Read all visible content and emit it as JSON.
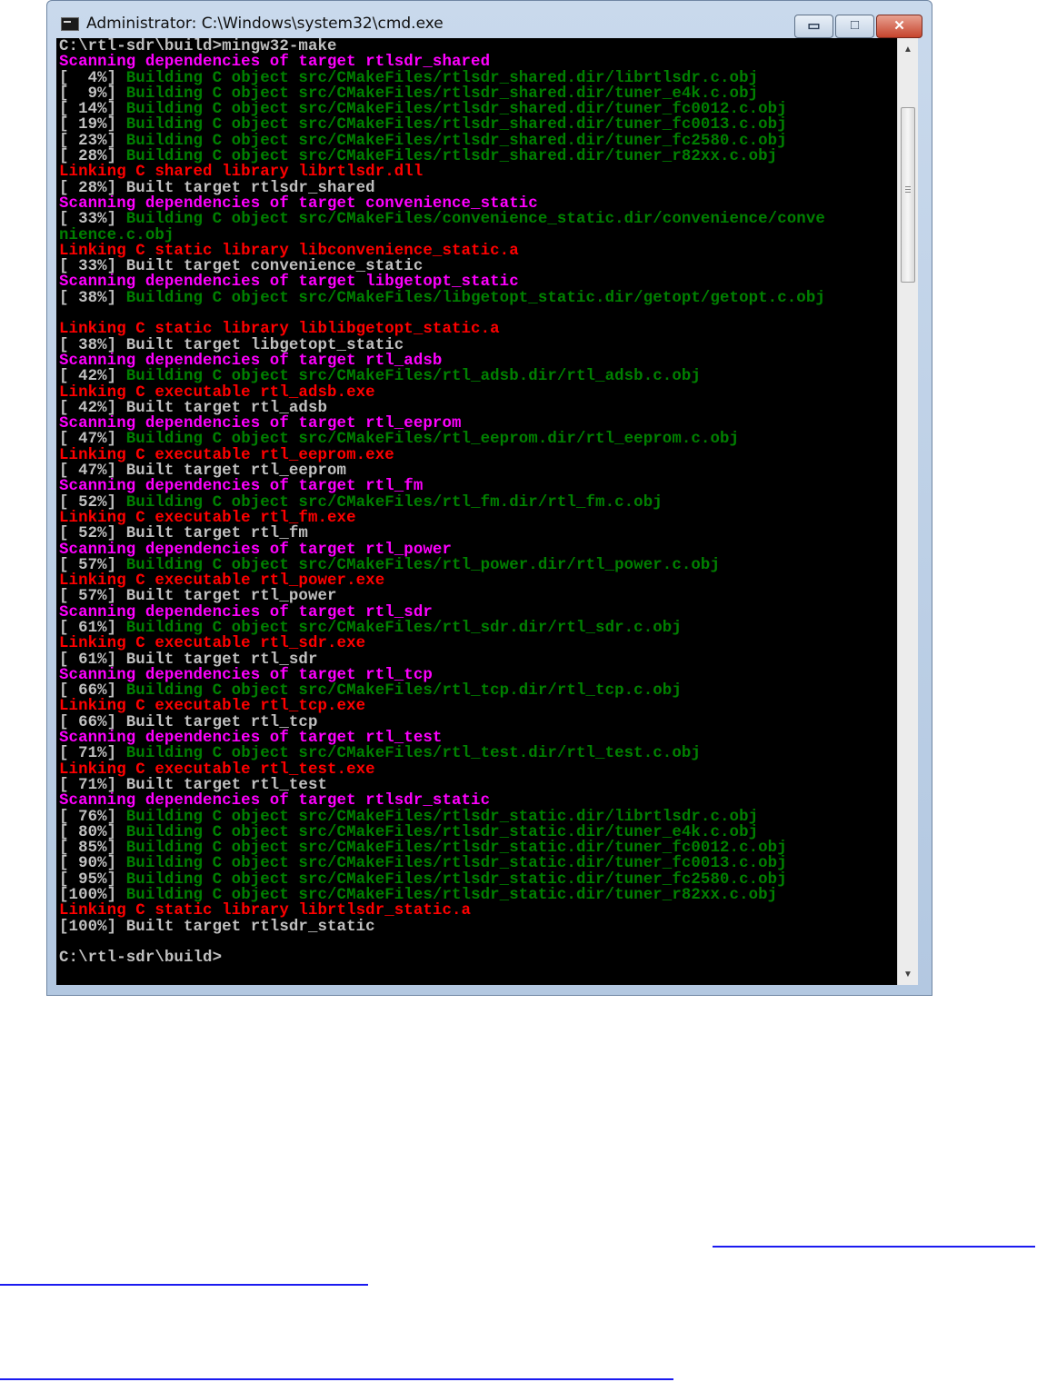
{
  "window": {
    "title": "Administrator: C:\\Windows\\system32\\cmd.exe",
    "controls": {
      "minimize": "▭",
      "maximize": "□",
      "close": "✕"
    }
  },
  "colors": {
    "white": "#c0c0c0",
    "magenta": "#ff00ff",
    "green": "#008000",
    "red": "#ff0000"
  },
  "console": {
    "lines": [
      {
        "c": "white",
        "t": "C:\\rtl-sdr\\build>mingw32-make"
      },
      {
        "c": "magenta",
        "t": "Scanning dependencies of target rtlsdr_shared"
      },
      {
        "c": "white",
        "t": "[  4%] ",
        "t2": "Building C object src/CMakeFiles/rtlsdr_shared.dir/librtlsdr.c.obj",
        "c2": "green"
      },
      {
        "c": "white",
        "t": "[  9%] ",
        "t2": "Building C object src/CMakeFiles/rtlsdr_shared.dir/tuner_e4k.c.obj",
        "c2": "green"
      },
      {
        "c": "white",
        "t": "[ 14%] ",
        "t2": "Building C object src/CMakeFiles/rtlsdr_shared.dir/tuner_fc0012.c.obj",
        "c2": "green"
      },
      {
        "c": "white",
        "t": "[ 19%] ",
        "t2": "Building C object src/CMakeFiles/rtlsdr_shared.dir/tuner_fc0013.c.obj",
        "c2": "green"
      },
      {
        "c": "white",
        "t": "[ 23%] ",
        "t2": "Building C object src/CMakeFiles/rtlsdr_shared.dir/tuner_fc2580.c.obj",
        "c2": "green"
      },
      {
        "c": "white",
        "t": "[ 28%] ",
        "t2": "Building C object src/CMakeFiles/rtlsdr_shared.dir/tuner_r82xx.c.obj",
        "c2": "green"
      },
      {
        "c": "red",
        "t": "Linking C shared library librtlsdr.dll"
      },
      {
        "c": "white",
        "t": "[ 28%] Built target rtlsdr_shared"
      },
      {
        "c": "magenta",
        "t": "Scanning dependencies of target convenience_static"
      },
      {
        "c": "white",
        "t": "[ 33%] ",
        "t2": "Building C object src/CMakeFiles/convenience_static.dir/convenience/conve",
        "c2": "green"
      },
      {
        "c": "green",
        "t": "nience.c.obj"
      },
      {
        "c": "red",
        "t": "Linking C static library libconvenience_static.a"
      },
      {
        "c": "white",
        "t": "[ 33%] Built target convenience_static"
      },
      {
        "c": "magenta",
        "t": "Scanning dependencies of target libgetopt_static"
      },
      {
        "c": "white",
        "t": "[ 38%] ",
        "t2": "Building C object src/CMakeFiles/libgetopt_static.dir/getopt/getopt.c.obj",
        "c2": "green"
      },
      {
        "c": "white",
        "t": ""
      },
      {
        "c": "red",
        "t": "Linking C static library liblibgetopt_static.a"
      },
      {
        "c": "white",
        "t": "[ 38%] Built target libgetopt_static"
      },
      {
        "c": "magenta",
        "t": "Scanning dependencies of target rtl_adsb"
      },
      {
        "c": "white",
        "t": "[ 42%] ",
        "t2": "Building C object src/CMakeFiles/rtl_adsb.dir/rtl_adsb.c.obj",
        "c2": "green"
      },
      {
        "c": "red",
        "t": "Linking C executable rtl_adsb.exe"
      },
      {
        "c": "white",
        "t": "[ 42%] Built target rtl_adsb"
      },
      {
        "c": "magenta",
        "t": "Scanning dependencies of target rtl_eeprom"
      },
      {
        "c": "white",
        "t": "[ 47%] ",
        "t2": "Building C object src/CMakeFiles/rtl_eeprom.dir/rtl_eeprom.c.obj",
        "c2": "green"
      },
      {
        "c": "red",
        "t": "Linking C executable rtl_eeprom.exe"
      },
      {
        "c": "white",
        "t": "[ 47%] Built target rtl_eeprom"
      },
      {
        "c": "magenta",
        "t": "Scanning dependencies of target rtl_fm"
      },
      {
        "c": "white",
        "t": "[ 52%] ",
        "t2": "Building C object src/CMakeFiles/rtl_fm.dir/rtl_fm.c.obj",
        "c2": "green"
      },
      {
        "c": "red",
        "t": "Linking C executable rtl_fm.exe"
      },
      {
        "c": "white",
        "t": "[ 52%] Built target rtl_fm"
      },
      {
        "c": "magenta",
        "t": "Scanning dependencies of target rtl_power"
      },
      {
        "c": "white",
        "t": "[ 57%] ",
        "t2": "Building C object src/CMakeFiles/rtl_power.dir/rtl_power.c.obj",
        "c2": "green"
      },
      {
        "c": "red",
        "t": "Linking C executable rtl_power.exe"
      },
      {
        "c": "white",
        "t": "[ 57%] Built target rtl_power"
      },
      {
        "c": "magenta",
        "t": "Scanning dependencies of target rtl_sdr"
      },
      {
        "c": "white",
        "t": "[ 61%] ",
        "t2": "Building C object src/CMakeFiles/rtl_sdr.dir/rtl_sdr.c.obj",
        "c2": "green"
      },
      {
        "c": "red",
        "t": "Linking C executable rtl_sdr.exe"
      },
      {
        "c": "white",
        "t": "[ 61%] Built target rtl_sdr"
      },
      {
        "c": "magenta",
        "t": "Scanning dependencies of target rtl_tcp"
      },
      {
        "c": "white",
        "t": "[ 66%] ",
        "t2": "Building C object src/CMakeFiles/rtl_tcp.dir/rtl_tcp.c.obj",
        "c2": "green"
      },
      {
        "c": "red",
        "t": "Linking C executable rtl_tcp.exe"
      },
      {
        "c": "white",
        "t": "[ 66%] Built target rtl_tcp"
      },
      {
        "c": "magenta",
        "t": "Scanning dependencies of target rtl_test"
      },
      {
        "c": "white",
        "t": "[ 71%] ",
        "t2": "Building C object src/CMakeFiles/rtl_test.dir/rtl_test.c.obj",
        "c2": "green"
      },
      {
        "c": "red",
        "t": "Linking C executable rtl_test.exe"
      },
      {
        "c": "white",
        "t": "[ 71%] Built target rtl_test"
      },
      {
        "c": "magenta",
        "t": "Scanning dependencies of target rtlsdr_static"
      },
      {
        "c": "white",
        "t": "[ 76%] ",
        "t2": "Building C object src/CMakeFiles/rtlsdr_static.dir/librtlsdr.c.obj",
        "c2": "green"
      },
      {
        "c": "white",
        "t": "[ 80%] ",
        "t2": "Building C object src/CMakeFiles/rtlsdr_static.dir/tuner_e4k.c.obj",
        "c2": "green"
      },
      {
        "c": "white",
        "t": "[ 85%] ",
        "t2": "Building C object src/CMakeFiles/rtlsdr_static.dir/tuner_fc0012.c.obj",
        "c2": "green"
      },
      {
        "c": "white",
        "t": "[ 90%] ",
        "t2": "Building C object src/CMakeFiles/rtlsdr_static.dir/tuner_fc0013.c.obj",
        "c2": "green"
      },
      {
        "c": "white",
        "t": "[ 95%] ",
        "t2": "Building C object src/CMakeFiles/rtlsdr_static.dir/tuner_fc2580.c.obj",
        "c2": "green"
      },
      {
        "c": "white",
        "t": "[100%] ",
        "t2": "Building C object src/CMakeFiles/rtlsdr_static.dir/tuner_r82xx.c.obj",
        "c2": "green"
      },
      {
        "c": "red",
        "t": "Linking C static library librtlsdr_static.a"
      },
      {
        "c": "white",
        "t": "[100%] Built target rtlsdr_static"
      },
      {
        "c": "white",
        "t": ""
      },
      {
        "c": "white",
        "t": "C:\\rtl-sdr\\build>"
      }
    ]
  },
  "scrollbar": {
    "up_arrow": "▲",
    "down_arrow": "▼"
  }
}
